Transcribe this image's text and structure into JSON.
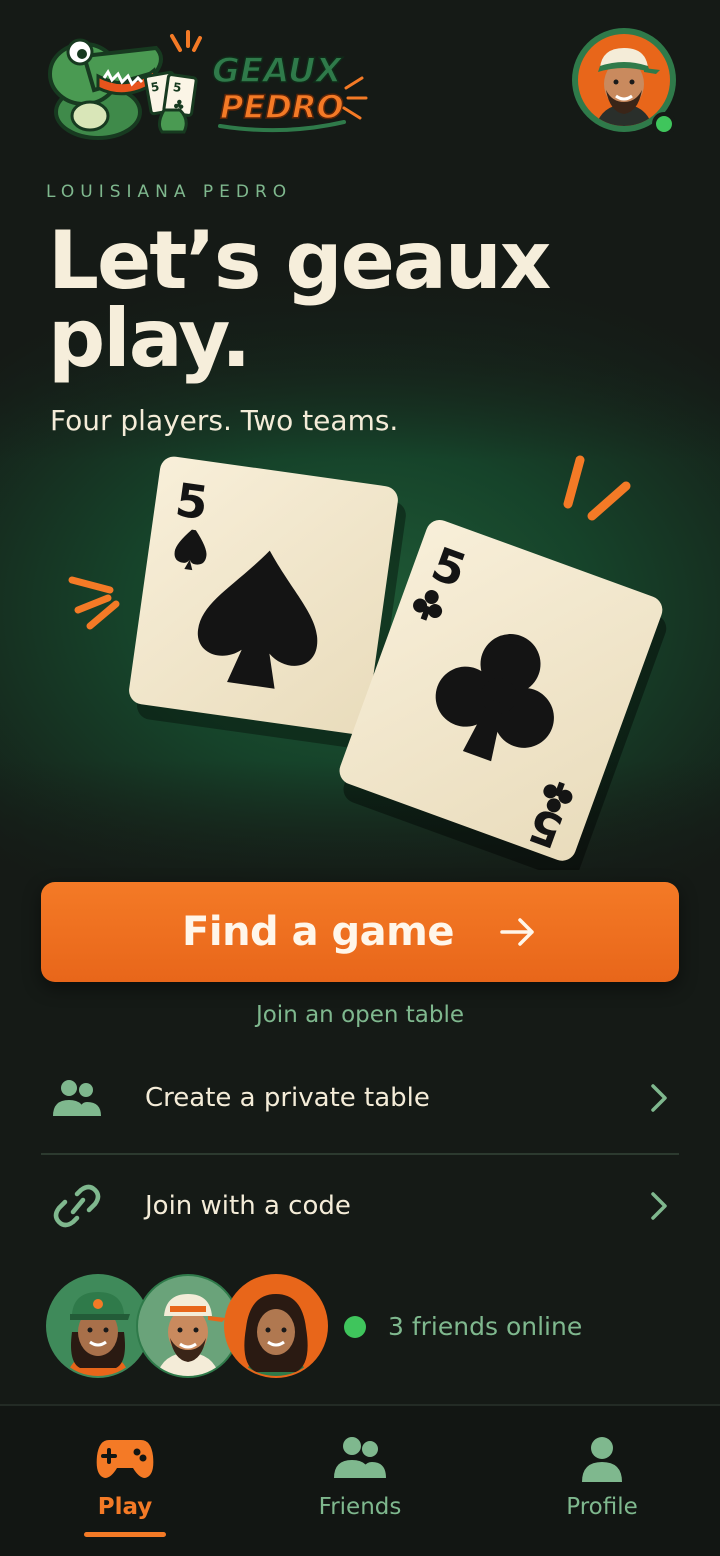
{
  "brand": {
    "line1": "GEAUX",
    "line2": "PEDRO"
  },
  "eyebrow": "LOUISIANA PEDRO",
  "headline": {
    "line1": "Let’s geaux",
    "line2": "play."
  },
  "subhead": "Four players. Two teams.",
  "cards": [
    {
      "rank": "5",
      "suit": "spades"
    },
    {
      "rank": "5",
      "suit": "clubs"
    }
  ],
  "cta": {
    "label": "Find a game",
    "sub": "Join an open table"
  },
  "options": [
    {
      "label": "Create a private table",
      "icon": "people-icon"
    },
    {
      "label": "Join with a code",
      "icon": "link-icon"
    }
  ],
  "friends": {
    "status": "3 friends online",
    "count": 3
  },
  "nav": [
    {
      "label": "Play",
      "icon": "gamepad-icon",
      "active": true
    },
    {
      "label": "Friends",
      "icon": "people-icon",
      "active": false
    },
    {
      "label": "Profile",
      "icon": "person-icon",
      "active": false
    }
  ],
  "colors": {
    "accent": "#f47a26",
    "muted_green": "#7fb88e",
    "online": "#3fc55c",
    "background": "#151a16"
  }
}
